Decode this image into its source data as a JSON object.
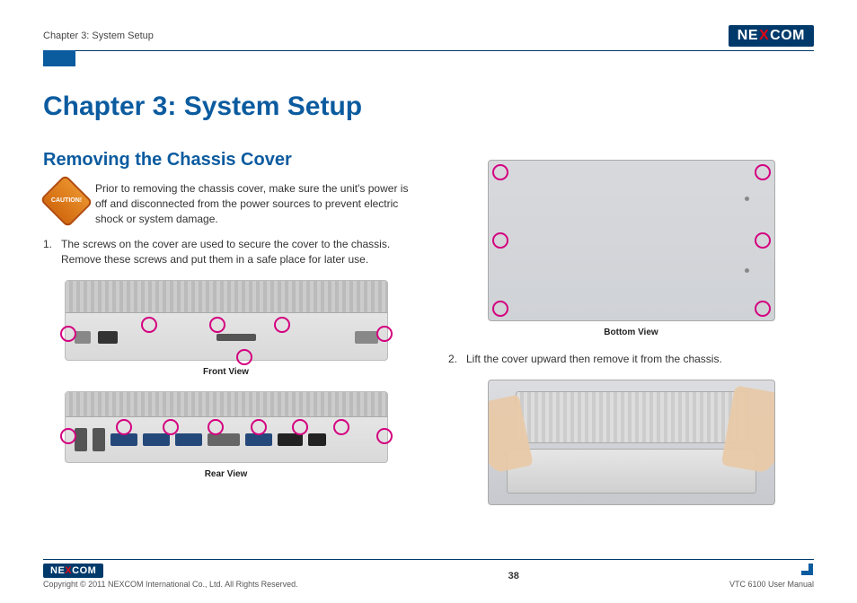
{
  "header": {
    "breadcrumb": "Chapter 3: System Setup",
    "logo_text_pre": "NE",
    "logo_text_x": "X",
    "logo_text_post": "COM"
  },
  "title": "Chapter 3: System Setup",
  "section": {
    "heading": "Removing the Chassis Cover",
    "caution_label": "CAUTION!",
    "caution": "Prior to removing the chassis cover, make sure the unit's power is off and disconnected from the power sources to prevent electric shock or system damage.",
    "step1_num": "1.",
    "step1": "The screws on the cover are used to secure the cover to the chassis. Remove these screws and put them in a safe place for later use.",
    "step2_num": "2.",
    "step2": "Lift the cover upward then remove it from the chassis.",
    "caption_front": "Front View",
    "caption_rear": "Rear View",
    "caption_bottom": "Bottom View"
  },
  "footer": {
    "copyright": "Copyright © 2011 NEXCOM International Co., Ltd. All Rights Reserved.",
    "page": "38",
    "manual": "VTC 6100 User Manual"
  }
}
